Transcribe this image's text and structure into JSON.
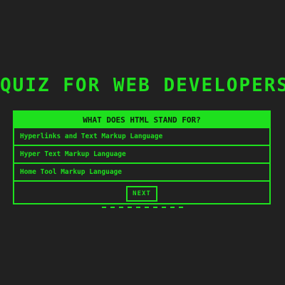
{
  "title": "QUIZ FOR WEB DEVELOPERS",
  "question": "WHAT DOES HTML STAND FOR?",
  "options": [
    "Hyperlinks and Text Markup Language",
    "Hyper Text Markup Language",
    "Home Tool Markup Language"
  ],
  "next_label": "NEXT",
  "progress": {
    "total_steps": 10
  },
  "colors": {
    "background": "#212121",
    "accent": "#1ee01e"
  }
}
